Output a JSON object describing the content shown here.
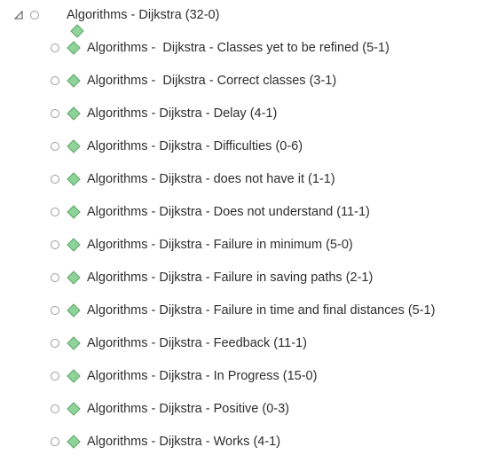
{
  "root": {
    "label": "Algorithms - Dijkstra (32-0)",
    "expanded": true,
    "icon": "green-diamond-node-icon"
  },
  "children": [
    {
      "label": "Algorithms -  Dijkstra - Classes yet to be refined (5-1)"
    },
    {
      "label": "Algorithms -  Dijkstra - Correct classes (3-1)"
    },
    {
      "label": "Algorithms - Dijkstra - Delay (4-1)"
    },
    {
      "label": "Algorithms - Dijkstra - Difficulties (0-6)"
    },
    {
      "label": "Algorithms - Dijkstra - does not have it (1-1)"
    },
    {
      "label": "Algorithms - Dijkstra - Does not understand (11-1)"
    },
    {
      "label": "Algorithms - Dijkstra - Failure in minimum (5-0)"
    },
    {
      "label": "Algorithms - Dijkstra - Failure in saving paths (2-1)"
    },
    {
      "label": "Algorithms - Dijkstra - Failure in time and final distances (5-1)"
    },
    {
      "label": "Algorithms - Dijkstra - Feedback (11-1)"
    },
    {
      "label": "Algorithms - Dijkstra - In Progress (15-0)"
    },
    {
      "label": "Algorithms - Dijkstra - Positive (0-3)"
    },
    {
      "label": "Algorithms - Dijkstra - Works (4-1)"
    }
  ],
  "colors": {
    "node_icon_fill": "#8fd39a",
    "node_icon_stroke": "#5aa565",
    "text": "#2e2e2e",
    "radio_border": "#9a9a9a"
  }
}
